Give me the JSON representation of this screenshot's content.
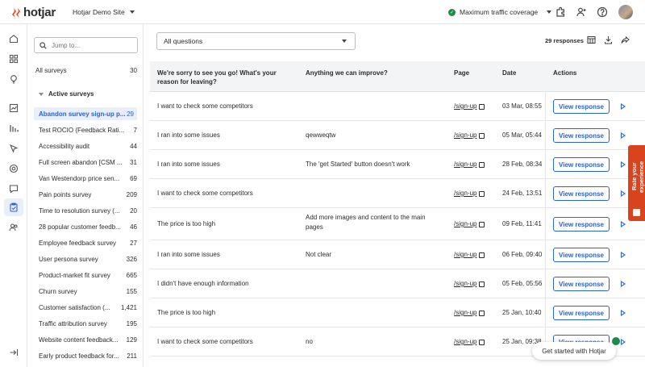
{
  "app": {
    "name": "hotjar",
    "site": "Hotjar Demo Site",
    "traffic": "Maximum traffic coverage"
  },
  "colors": {
    "accent": "#2962d9",
    "brand": "#fd3a0b",
    "success": "#1f8a4c",
    "feedback_tab": "#d9431e"
  },
  "sidebar": {
    "search_placeholder": "Jump to...",
    "all_surveys": {
      "label": "All surveys",
      "count": "30"
    },
    "section_label": "Active surveys",
    "items": [
      {
        "label": "Abandon survey sign-up p...",
        "count": "29",
        "active": true
      },
      {
        "label": "Test ROCIO (Feedback Rati...",
        "count": "7"
      },
      {
        "label": "Accessibility audit",
        "count": "44"
      },
      {
        "label": "Full screen abandon [CSM ...",
        "count": "31"
      },
      {
        "label": "Van Westendorp price sen...",
        "count": "69"
      },
      {
        "label": "Pain points survey",
        "count": "209"
      },
      {
        "label": "Time to resolution survey (...",
        "count": "20"
      },
      {
        "label": "28 popular customer feedb...",
        "count": "46"
      },
      {
        "label": "Employee feedback survey",
        "count": "27"
      },
      {
        "label": "User persona survey",
        "count": "326"
      },
      {
        "label": "Product-market fit survey",
        "count": "665"
      },
      {
        "label": "Churn survey",
        "count": "155"
      },
      {
        "label": "Customer satisfaction (...",
        "count": "1,421"
      },
      {
        "label": "Traffic attribution survey",
        "count": "195"
      },
      {
        "label": "Website content feedback...",
        "count": "129"
      },
      {
        "label": "Early product feedback for...",
        "count": "211"
      }
    ]
  },
  "main": {
    "question_filter": "All questions",
    "response_count": "29 responses",
    "columns": {
      "q1": "We're sorry to see you go! What's your reason for leaving?",
      "q2": "Anything we can improve?",
      "page": "Page",
      "date": "Date",
      "actions": "Actions"
    },
    "view_label": "View response",
    "rows": [
      {
        "q1": "I want to check some competitors",
        "q2": "",
        "page": "/sign-up",
        "date": "03 Mar, 08:55"
      },
      {
        "q1": "I ran into some issues",
        "q2": "qewweqtw",
        "page": "/sign-up",
        "date": "05 Mar, 05:44"
      },
      {
        "q1": "I ran into some issues",
        "q2": "The 'get Started' button doesn't work",
        "page": "/sign-up",
        "date": "28 Feb, 08:34"
      },
      {
        "q1": "I want to check some competitors",
        "q2": "",
        "page": "/sign-up",
        "date": "24 Feb, 13:51"
      },
      {
        "q1": "The price is too high",
        "q2": "Add more images and content to the main pages",
        "page": "/sign-up",
        "date": "09 Feb, 11:41"
      },
      {
        "q1": "I ran into some issues",
        "q2": "Not clear",
        "page": "/sign-up",
        "date": "06 Feb, 09:40"
      },
      {
        "q1": "I didn't have enough information",
        "q2": "",
        "page": "/sign-up",
        "date": "05 Feb, 05:56"
      },
      {
        "q1": "The price is too high",
        "q2": "",
        "page": "/sign-up",
        "date": "25 Jan, 10:40"
      },
      {
        "q1": "I want to check some competitors",
        "q2": "no",
        "page": "/sign-up",
        "date": "25 Jan, 09:38"
      }
    ]
  },
  "feedback_tab": "Rate your experience",
  "toast": "Get started with Hotjar"
}
